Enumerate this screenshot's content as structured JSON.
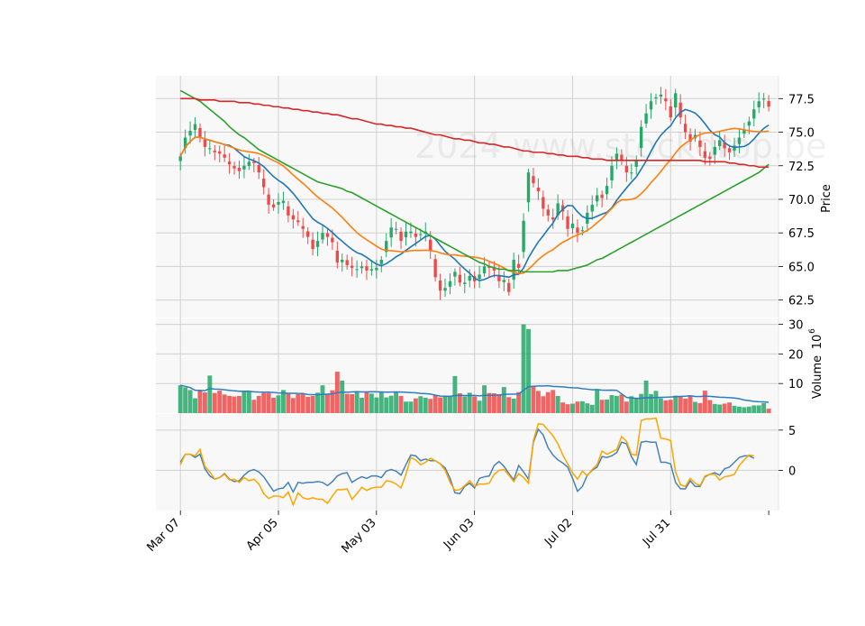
{
  "watermark": "2024 www.stockdrop.be",
  "panels": {
    "price": {
      "ylabel": "Price"
    },
    "volume": {
      "ylabel": "Volume",
      "exponent_label": "10",
      "exponent_power": "6"
    }
  },
  "chart_data": [
    {
      "type": "candlestick",
      "panel": "price",
      "ylabel": "Price",
      "ylim": [
        61.2,
        79.2
      ],
      "y_ticks": [
        "62.5",
        "65.0",
        "67.5",
        "70.0",
        "72.5",
        "75.0",
        "77.5"
      ],
      "y_tick_values": [
        62.5,
        65.0,
        67.5,
        70.0,
        72.5,
        75.0,
        77.5
      ],
      "x_tick_labels": [
        "Mar 07",
        "Apr 05",
        "May 03",
        "Jun 03",
        "Jul 02",
        "Jul 31"
      ],
      "x_tick_index": [
        0,
        20,
        40,
        60,
        80,
        100
      ],
      "x_range": [
        -5,
        122
      ],
      "grid": true,
      "up_color": "#26a86a",
      "down_color": "#ef4a4a",
      "close": [
        73.2,
        74.6,
        75.1,
        75.6,
        74.6,
        73.9,
        73.8,
        73.5,
        73.4,
        73.1,
        72.6,
        72.3,
        72.1,
        72.5,
        72.8,
        72.7,
        72.0,
        70.9,
        69.6,
        69.4,
        69.8,
        69.9,
        68.8,
        68.5,
        68.3,
        67.8,
        67.2,
        66.3,
        66.9,
        67.5,
        67.2,
        66.8,
        65.3,
        65.5,
        65.1,
        64.9,
        64.8,
        65.0,
        64.7,
        64.8,
        64.9,
        65.5,
        66.9,
        67.9,
        67.8,
        66.9,
        67.6,
        67.6,
        67.2,
        67.4,
        67.6,
        66.2,
        64.2,
        63.2,
        63.4,
        63.9,
        64.6,
        63.8,
        63.8,
        64.3,
        63.9,
        64.4,
        65.0,
        64.9,
        64.7,
        63.9,
        64.0,
        63.1,
        65.5,
        64.9,
        68.4,
        72.0,
        71.2,
        70.6,
        69.3,
        68.8,
        68.5,
        69.7,
        69.1,
        67.8,
        68.2,
        67.5,
        67.7,
        69.0,
        69.6,
        70.3,
        70.1,
        71.0,
        72.5,
        73.4,
        72.9,
        72.0,
        72.0,
        72.9,
        75.4,
        76.4,
        77.3,
        77.6,
        77.8,
        77.3,
        76.1,
        77.9,
        76.1,
        75.0,
        74.3,
        74.8,
        73.9,
        73.1,
        73.0,
        73.9,
        74.4,
        73.8,
        73.5,
        74.0,
        74.6,
        75.2,
        75.8,
        76.7,
        77.3,
        77.5,
        76.9
      ],
      "volume": [
        9.4,
        8.7,
        7.8,
        5.0,
        7.6,
        7.0,
        12.7,
        6.8,
        7.6,
        6.3,
        5.8,
        5.6,
        5.8,
        7.4,
        7.2,
        4.5,
        5.8,
        6.8,
        6.8,
        5.2,
        6.0,
        7.8,
        6.6,
        5.1,
        6.4,
        6.7,
        5.5,
        5.8,
        6.9,
        9.4,
        6.6,
        7.7,
        14.0,
        11.0,
        6.5,
        6.4,
        7.4,
        5.2,
        7.2,
        6.6,
        5.3,
        7.0,
        5.3,
        5.9,
        7.0,
        5.8,
        3.9,
        3.9,
        5.0,
        5.7,
        5.2,
        4.8,
        6.0,
        5.3,
        5.6,
        5.6,
        12.5,
        6.7,
        5.6,
        6.9,
        5.6,
        4.2,
        9.4,
        6.8,
        6.7,
        6.4,
        8.8,
        5.4,
        4.9,
        7.1,
        30.0,
        28.4,
        9.3,
        7.5,
        5.7,
        7.1,
        7.8,
        5.8,
        3.6,
        3.0,
        3.2,
        3.9,
        4.0,
        3.3,
        2.8,
        7.9,
        4.5,
        4.6,
        6.1,
        5.8,
        6.3,
        3.9,
        5.7,
        5.0,
        6.5,
        11.0,
        6.4,
        7.5,
        5.0,
        4.3,
        4.5,
        5.9,
        5.6,
        4.9,
        5.8,
        3.8,
        3.4,
        7.6,
        4.4,
        3.1,
        2.9,
        3.2,
        3.6,
        2.5,
        2.2,
        2.0,
        2.2,
        2.6,
        2.6,
        3.4,
        1.5
      ],
      "volume_ylim": [
        0,
        32
      ],
      "volume_ticks": [
        "10",
        "20",
        "30"
      ],
      "volume_tick_values": [
        10,
        20,
        30
      ],
      "volume_ma_color": "#2f7dc0",
      "moving_averages": [
        {
          "period": 10,
          "color": "#1f77b4"
        },
        {
          "period": 20,
          "color": "#ff7f0e"
        },
        {
          "period": 50,
          "color": "#2ca02c",
          "values": [
            78.1,
            77.9,
            77.7,
            77.5,
            77.3,
            77.0,
            76.7,
            76.4,
            76.1,
            75.8,
            75.4,
            75.1,
            74.8,
            74.6,
            74.3,
            74.0,
            73.7,
            73.5,
            73.3,
            73.1,
            72.9,
            72.7,
            72.5,
            72.3,
            72.1,
            71.9,
            71.7,
            71.5,
            71.3,
            71.2,
            71.1,
            71.0,
            70.9,
            70.8,
            70.6,
            70.5,
            70.3,
            70.1,
            69.9,
            69.7,
            69.5,
            69.3,
            69.1,
            68.9,
            68.7,
            68.5,
            68.3,
            68.1,
            67.9,
            67.7,
            67.5,
            67.3,
            67.1,
            66.9,
            66.7,
            66.5,
            66.3,
            66.1,
            65.9,
            65.7,
            65.5,
            65.3,
            65.2,
            65.0,
            64.9,
            64.8,
            64.8,
            64.7,
            64.7,
            64.7,
            64.6,
            64.6,
            64.6,
            64.6,
            64.6,
            64.6,
            64.6,
            64.7,
            64.7,
            64.7,
            64.8,
            64.9,
            65.0,
            65.1,
            65.3,
            65.5,
            65.6,
            65.8,
            66.0,
            66.2,
            66.4,
            66.6,
            66.8,
            67.0,
            67.2,
            67.4,
            67.6,
            67.8,
            68.0,
            68.2,
            68.4,
            68.6,
            68.8,
            69.0,
            69.2,
            69.4,
            69.6,
            69.8,
            70.0,
            70.2,
            70.4,
            70.6,
            70.8,
            71.0,
            71.2,
            71.4,
            71.6,
            71.8,
            72.0,
            72.3,
            72.6
          ]
        },
        {
          "period": 200,
          "color": "#d62728",
          "values": [
            77.5,
            77.5,
            77.5,
            77.5,
            77.4,
            77.4,
            77.4,
            77.4,
            77.3,
            77.3,
            77.3,
            77.3,
            77.2,
            77.2,
            77.2,
            77.1,
            77.1,
            77.0,
            77.0,
            76.9,
            76.9,
            76.8,
            76.8,
            76.7,
            76.7,
            76.6,
            76.6,
            76.5,
            76.5,
            76.4,
            76.4,
            76.3,
            76.3,
            76.2,
            76.1,
            76.0,
            76.0,
            75.9,
            75.8,
            75.7,
            75.6,
            75.6,
            75.5,
            75.5,
            75.4,
            75.4,
            75.3,
            75.3,
            75.2,
            75.1,
            75.0,
            74.9,
            74.8,
            74.8,
            74.7,
            74.6,
            74.5,
            74.5,
            74.4,
            74.4,
            74.3,
            74.2,
            74.2,
            74.1,
            74.1,
            74.0,
            73.9,
            73.9,
            73.8,
            73.7,
            73.6,
            73.6,
            73.5,
            73.5,
            73.5,
            73.4,
            73.4,
            73.3,
            73.3,
            73.2,
            73.2,
            73.2,
            73.1,
            73.1,
            73.0,
            73.0,
            73.0,
            72.9,
            72.9,
            72.9,
            72.9,
            72.9,
            72.9,
            72.9,
            72.9,
            72.9,
            72.9,
            72.9,
            72.9,
            72.9,
            72.9,
            72.9,
            72.9,
            72.9,
            72.9,
            72.9,
            72.9,
            72.8,
            72.8,
            72.8,
            72.8,
            72.8,
            72.7,
            72.7,
            72.6,
            72.6,
            72.5,
            72.5,
            72.4,
            72.4,
            72.4
          ]
        }
      ]
    },
    {
      "type": "line",
      "panel": "oscillator",
      "y_ticks": [
        "0",
        "5"
      ],
      "y_tick_values": [
        0,
        5
      ],
      "ylim": [
        -5,
        7
      ],
      "series": [
        {
          "color": "#4682b4",
          "values": [
            1.0,
            2.0,
            2.0,
            1.6,
            2.0,
            0.2,
            -0.7,
            -1.1,
            -0.9,
            -0.4,
            -1.1,
            -1.4,
            -1.3,
            -0.6,
            -0.1,
            0.1,
            -0.2,
            -0.8,
            -1.7,
            -2.6,
            -2.3,
            -2.2,
            -1.5,
            -2.7,
            -1.5,
            -1.6,
            -1.5,
            -1.5,
            -1.4,
            -1.5,
            -1.9,
            -1.4,
            -0.7,
            -0.4,
            -0.3,
            -1.5,
            -1.1,
            -0.8,
            -1.0,
            -0.7,
            -0.7,
            -0.9,
            -0.1,
            0.1,
            -0.1,
            -0.6,
            0.7,
            1.9,
            1.8,
            1.2,
            1.4,
            1.2,
            1.2,
            0.8,
            0.3,
            -1.0,
            -2.8,
            -2.9,
            -2.0,
            -1.6,
            -2.2,
            -1.0,
            -0.8,
            -0.7,
            0.6,
            1.1,
            0.5,
            -0.4,
            -1.2,
            0.6,
            -0.2,
            -1.1,
            3.5,
            5.1,
            4.4,
            2.8,
            1.9,
            1.3,
            0.9,
            0.4,
            -1.0,
            -2.6,
            -2.0,
            -0.6,
            0.0,
            0.4,
            1.7,
            1.6,
            1.8,
            2.2,
            3.5,
            3.3,
            1.7,
            0.7,
            3.5,
            3.6,
            3.5,
            3.5,
            1.0,
            1.0,
            0.8,
            -1.5,
            -2.3,
            -2.3,
            -1.3,
            -2.0,
            -2.0,
            -0.8,
            -0.5,
            -0.3,
            -0.6,
            0.2,
            0.4,
            1.0,
            1.6,
            1.8,
            1.8,
            1.5
          ]
        },
        {
          "color": "#ffa500",
          "values": [
            0.7,
            2.0,
            2.0,
            1.8,
            2.6,
            0.5,
            -0.2,
            -1.1,
            -0.9,
            -0.5,
            -1.2,
            -1.1,
            -1.5,
            -0.9,
            -1.3,
            -1.1,
            -1.7,
            -2.9,
            -3.5,
            -3.2,
            -3.2,
            -3.4,
            -2.7,
            -4.3,
            -2.8,
            -3.4,
            -3.6,
            -3.4,
            -3.6,
            -3.6,
            -4.1,
            -3.2,
            -2.4,
            -2.4,
            -2.3,
            -3.6,
            -2.9,
            -2.1,
            -2.5,
            -2.2,
            -2.1,
            -2.1,
            -1.3,
            -1.4,
            -1.7,
            -2.2,
            -0.5,
            1.6,
            1.3,
            0.7,
            1.0,
            1.5,
            1.2,
            0.8,
            0.0,
            -1.5,
            -2.5,
            -2.4,
            -1.9,
            -1.3,
            -2.0,
            -1.7,
            -1.7,
            -1.6,
            -0.5,
            0.0,
            0.1,
            -0.6,
            -1.4,
            -0.4,
            -0.9,
            -1.6,
            3.7,
            5.8,
            5.7,
            5.0,
            4.3,
            3.3,
            1.9,
            0.8,
            -0.3,
            -1.1,
            -0.1,
            -0.7,
            0.1,
            0.7,
            2.4,
            2.0,
            2.3,
            2.6,
            4.2,
            3.6,
            2.0,
            1.9,
            6.2,
            6.4,
            6.4,
            6.5,
            4.0,
            3.9,
            3.7,
            -0.2,
            -1.8,
            -2.0,
            -1.0,
            -1.6,
            -1.9,
            -0.7,
            -0.5,
            -0.5,
            -1.2,
            -0.8,
            -0.7,
            -0.5,
            0.6,
            1.3,
            1.9,
            1.8
          ]
        }
      ]
    }
  ]
}
